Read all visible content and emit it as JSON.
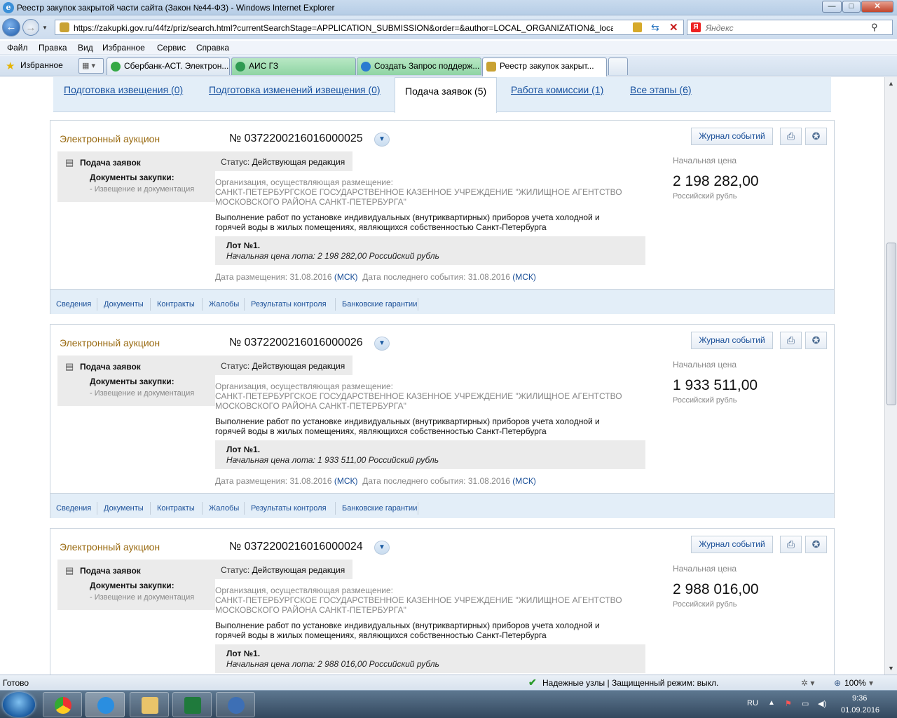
{
  "window": {
    "title": "Реестр закупок закрытой части сайта (Закон №44-ФЗ) - Windows Internet Explorer",
    "btn_min": "—",
    "btn_max": "□",
    "btn_close": "✕"
  },
  "address": {
    "url": "https://zakupki.gov.ru/44fz/priz/search.html?currentSearchStage=APPLICATION_SUBMISSION&order=&author=LOCAL_ORGANIZATION&_localU",
    "search_placeholder": "Яндекс"
  },
  "menu": [
    "Файл",
    "Правка",
    "Вид",
    "Избранное",
    "Сервис",
    "Справка"
  ],
  "favorites": {
    "label": "Избранное"
  },
  "tabs": [
    {
      "label": "Сбербанк-АСТ. Электрон..."
    },
    {
      "label": "АИС ГЗ"
    },
    {
      "label": "Создать Запрос поддерж..."
    },
    {
      "label": "Реестр закупок закрыт..."
    }
  ],
  "stages": [
    {
      "label": "Подготовка извещения (0)"
    },
    {
      "label": "Подготовка изменений извещения (0)"
    },
    {
      "label": "Подача заявок (5)"
    },
    {
      "label": "Работа комиссии (1)"
    },
    {
      "label": "Все этапы (6)"
    }
  ],
  "common": {
    "type": "Электронный аукцион",
    "journal": "Журнал событий",
    "phase": "Подача заявок",
    "docs_label": "Документы закупки:",
    "docs_sub": "- Извещение и документация",
    "status_label": "Статус:",
    "status_value": "Действующая редакция",
    "org_label": "Организация, осуществляющая размещение:",
    "org_name1": "САНКТ-ПЕТЕРБУРГСКОЕ ГОСУДАРСТВЕННОЕ КАЗЕННОЕ УЧРЕЖДЕНИЕ \"ЖИЛИЩНОЕ АГЕНТСТВО",
    "org_name2": "МОСКОВСКОГО РАЙОНА САНКТ-ПЕТЕРБУРГА\"",
    "desc1": "Выполнение работ по установке индивидуальных (внутриквартирных) приборов учета холодной и",
    "desc2": "горячей воды в жилых помещениях, являющихся собственностью Санкт-Петербурга",
    "lot_title": "Лот №1.",
    "date_label": "Дата размещения:",
    "last_label": "Дата последнего события:",
    "tz": "(МСК)",
    "price_label": "Начальная цена",
    "currency": "Российский рубль",
    "footer": [
      "Сведения",
      "Документы",
      "Контракты",
      "Жалобы",
      "Результаты контроля",
      "Банковские гарантии"
    ]
  },
  "cards": [
    {
      "number": "№ 0372200216016000025",
      "lot_price": "Начальная цена лота: 2 198 282,00 Российский рубль",
      "date": "31.08.2016",
      "last_date": "31.08.2016",
      "price": "2 198 282,00"
    },
    {
      "number": "№ 0372200216016000026",
      "lot_price": "Начальная цена лота: 1 933 511,00 Российский рубль",
      "date": "31.08.2016",
      "last_date": "31.08.2016",
      "price": "1 933 511,00"
    },
    {
      "number": "№ 0372200216016000024",
      "lot_price": "Начальная цена лота: 2 988 016,00 Российский рубль",
      "date": "",
      "last_date": "",
      "price": "2 988 016,00"
    }
  ],
  "status_bar": {
    "left": "Готово",
    "zone": "Надежные узлы | Защищенный режим: выкл.",
    "zoom": "100%"
  },
  "tray": {
    "lang": "RU",
    "time": "9:36",
    "date": "01.09.2016"
  }
}
